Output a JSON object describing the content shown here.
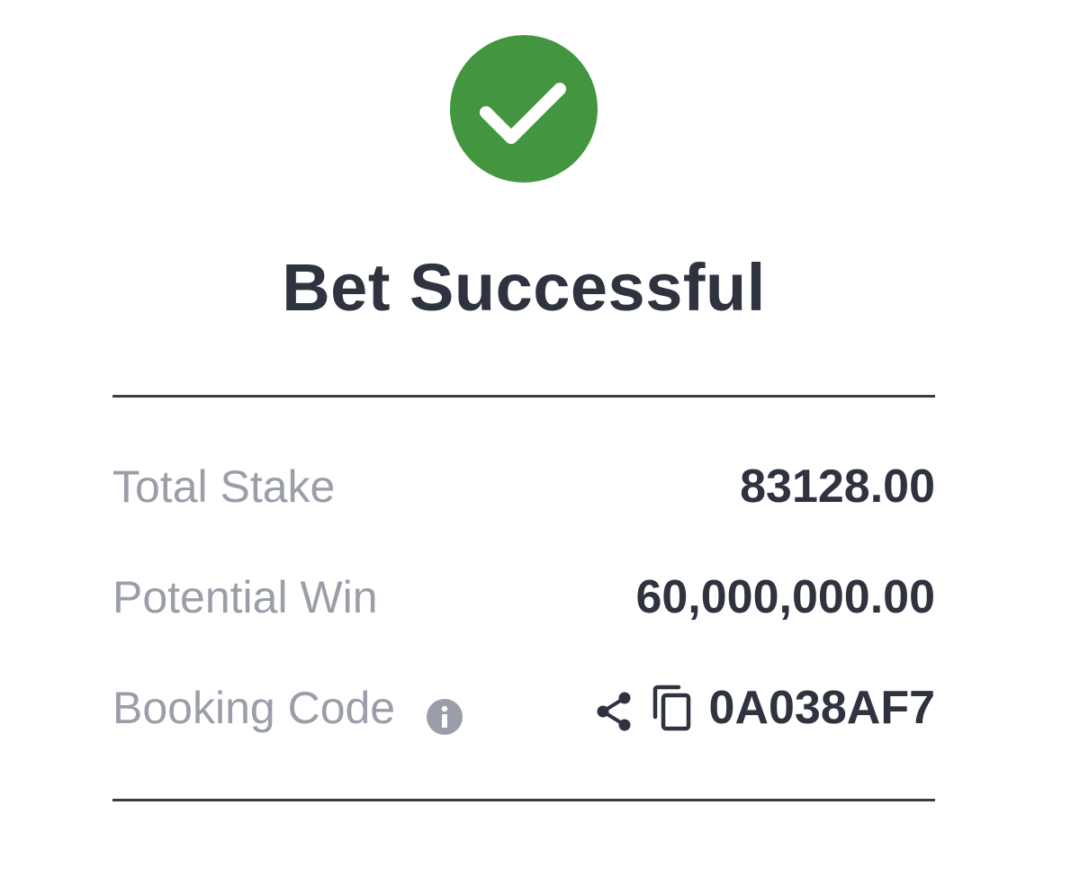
{
  "status": {
    "icon": "check-circle-icon",
    "accent_color": "#43963f",
    "title": "Bet Successful"
  },
  "summary": {
    "total_stake": {
      "label": "Total Stake",
      "value": "83128.00"
    },
    "potential_win": {
      "label": "Potential Win",
      "value": "60,000,000.00"
    },
    "booking_code": {
      "label": "Booking Code",
      "value": "0A038AF7",
      "info_icon": "info-icon",
      "share_icon": "share-icon",
      "copy_icon": "copy-icon"
    }
  }
}
